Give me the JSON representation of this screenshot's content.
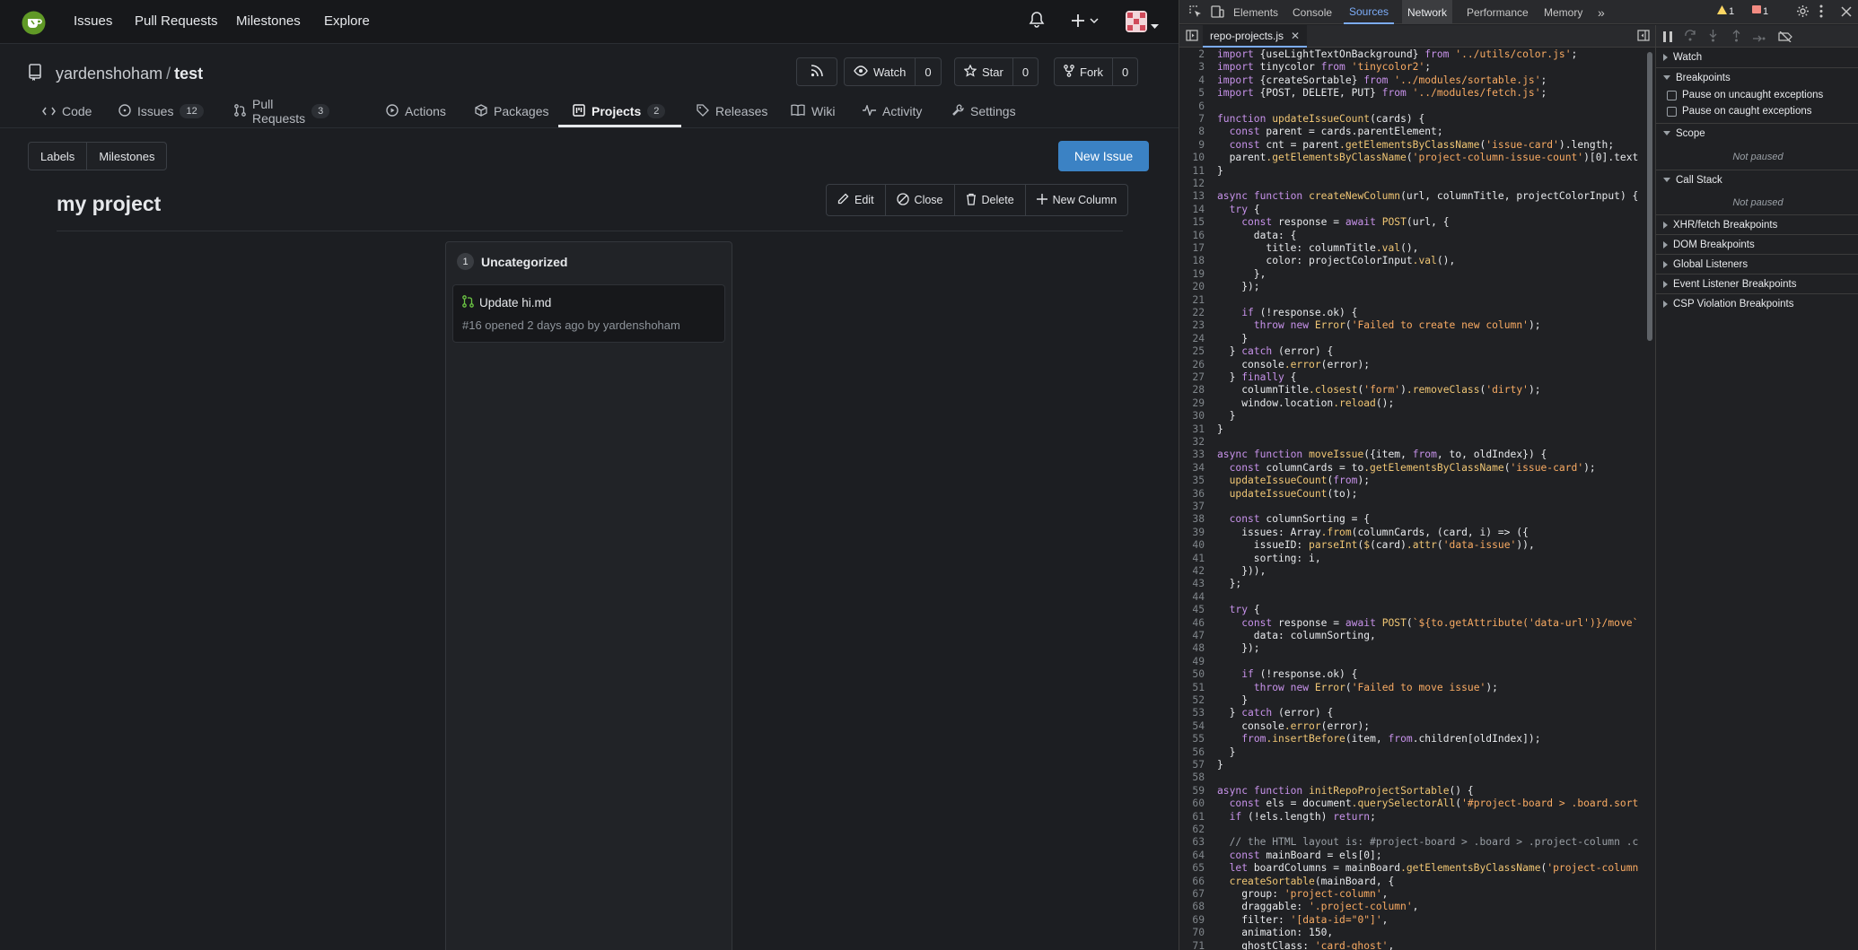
{
  "nav": {
    "links": [
      "Issues",
      "Pull Requests",
      "Milestones",
      "Explore"
    ]
  },
  "repo": {
    "owner": "yardenshoham",
    "separator": "/",
    "name": "test",
    "watch_label": "Watch",
    "watch_count": "0",
    "star_label": "Star",
    "star_count": "0",
    "fork_label": "Fork",
    "fork_count": "0",
    "tabs": [
      {
        "label": "Code"
      },
      {
        "label": "Issues",
        "badge": "12"
      },
      {
        "label": "Pull Requests",
        "badge": "3"
      },
      {
        "label": "Actions"
      },
      {
        "label": "Packages"
      },
      {
        "label": "Projects",
        "badge": "2"
      },
      {
        "label": "Releases"
      },
      {
        "label": "Wiki"
      },
      {
        "label": "Activity"
      },
      {
        "label": "Settings"
      }
    ]
  },
  "toolbar": {
    "labels": "Labels",
    "milestones": "Milestones",
    "new_issue": "New Issue"
  },
  "project": {
    "title": "my project",
    "actions": {
      "edit": "Edit",
      "close": "Close",
      "delete": "Delete",
      "new_column": "New Column"
    },
    "column": {
      "count": "1",
      "title": "Uncategorized",
      "card": {
        "title": "Update hi.md",
        "meta": "#16 opened 2 days ago by yardenshoham"
      }
    }
  },
  "devtools": {
    "tabs": [
      "Elements",
      "Console",
      "Sources",
      "Network",
      "Performance",
      "Memory"
    ],
    "more": "»",
    "warnings": "1",
    "errors": "1",
    "file_tab": "repo-projects.js",
    "code": [
      [
        "2",
        "import {useLightTextOnBackground} from '../utils/color.js';"
      ],
      [
        "3",
        "import tinycolor from 'tinycolor2';"
      ],
      [
        "4",
        "import {createSortable} from '../modules/sortable.js';"
      ],
      [
        "5",
        "import {POST, DELETE, PUT} from '../modules/fetch.js';"
      ],
      [
        "6",
        ""
      ],
      [
        "7",
        "function updateIssueCount(cards) {"
      ],
      [
        "8",
        "  const parent = cards.parentElement;"
      ],
      [
        "9",
        "  const cnt = parent.getElementsByClassName('issue-card').length;"
      ],
      [
        "10",
        "  parent.getElementsByClassName('project-column-issue-count')[0].text"
      ],
      [
        "11",
        "}"
      ],
      [
        "12",
        ""
      ],
      [
        "13",
        "async function createNewColumn(url, columnTitle, projectColorInput) {"
      ],
      [
        "14",
        "  try {"
      ],
      [
        "15",
        "    const response = await POST(url, {"
      ],
      [
        "16",
        "      data: {"
      ],
      [
        "17",
        "        title: columnTitle.val(),"
      ],
      [
        "18",
        "        color: projectColorInput.val(),"
      ],
      [
        "19",
        "      },"
      ],
      [
        "20",
        "    });"
      ],
      [
        "21",
        ""
      ],
      [
        "22",
        "    if (!response.ok) {"
      ],
      [
        "23",
        "      throw new Error('Failed to create new column');"
      ],
      [
        "24",
        "    }"
      ],
      [
        "25",
        "  } catch (error) {"
      ],
      [
        "26",
        "    console.error(error);"
      ],
      [
        "27",
        "  } finally {"
      ],
      [
        "28",
        "    columnTitle.closest('form').removeClass('dirty');"
      ],
      [
        "29",
        "    window.location.reload();"
      ],
      [
        "30",
        "  }"
      ],
      [
        "31",
        "}"
      ],
      [
        "32",
        ""
      ],
      [
        "33",
        "async function moveIssue({item, from, to, oldIndex}) {"
      ],
      [
        "34",
        "  const columnCards = to.getElementsByClassName('issue-card');"
      ],
      [
        "35",
        "  updateIssueCount(from);"
      ],
      [
        "36",
        "  updateIssueCount(to);"
      ],
      [
        "37",
        ""
      ],
      [
        "38",
        "  const columnSorting = {"
      ],
      [
        "39",
        "    issues: Array.from(columnCards, (card, i) => ({"
      ],
      [
        "40",
        "      issueID: parseInt($(card).attr('data-issue')),"
      ],
      [
        "41",
        "      sorting: i,"
      ],
      [
        "42",
        "    })),"
      ],
      [
        "43",
        "  };"
      ],
      [
        "44",
        ""
      ],
      [
        "45",
        "  try {"
      ],
      [
        "46",
        "    const response = await POST(`${to.getAttribute('data-url')}/move`"
      ],
      [
        "47",
        "      data: columnSorting,"
      ],
      [
        "48",
        "    });"
      ],
      [
        "49",
        ""
      ],
      [
        "50",
        "    if (!response.ok) {"
      ],
      [
        "51",
        "      throw new Error('Failed to move issue');"
      ],
      [
        "52",
        "    }"
      ],
      [
        "53",
        "  } catch (error) {"
      ],
      [
        "54",
        "    console.error(error);"
      ],
      [
        "55",
        "    from.insertBefore(item, from.children[oldIndex]);"
      ],
      [
        "56",
        "  }"
      ],
      [
        "57",
        "}"
      ],
      [
        "58",
        ""
      ],
      [
        "59",
        "async function initRepoProjectSortable() {"
      ],
      [
        "60",
        "  const els = document.querySelectorAll('#project-board > .board.sort"
      ],
      [
        "61",
        "  if (!els.length) return;"
      ],
      [
        "62",
        ""
      ],
      [
        "63",
        "  // the HTML layout is: #project-board > .board > .project-column .c"
      ],
      [
        "64",
        "  const mainBoard = els[0];"
      ],
      [
        "65",
        "  let boardColumns = mainBoard.getElementsByClassName('project-column"
      ],
      [
        "66",
        "  createSortable(mainBoard, {"
      ],
      [
        "67",
        "    group: 'project-column',"
      ],
      [
        "68",
        "    draggable: '.project-column',"
      ],
      [
        "69",
        "    filter: '[data-id=\"0\"]',"
      ],
      [
        "70",
        "    animation: 150,"
      ],
      [
        "71",
        "    ghostClass: 'card-ghost',"
      ]
    ],
    "debugger": {
      "watch": "Watch",
      "breakpoints": "Breakpoints",
      "pause_uncaught": "Pause on uncaught exceptions",
      "pause_caught": "Pause on caught exceptions",
      "scope": "Scope",
      "scope_status": "Not paused",
      "call_stack": "Call Stack",
      "call_stack_status": "Not paused",
      "sections": [
        "XHR/fetch Breakpoints",
        "DOM Breakpoints",
        "Global Listeners",
        "Event Listener Breakpoints",
        "CSP Violation Breakpoints"
      ]
    }
  },
  "colors": {
    "accent_blue": "#3b82c4",
    "devtools_selected": "#7cacf8",
    "code_keyword": "#c792ea",
    "code_string": "#f9ab63",
    "code_function": "#f0c674"
  }
}
